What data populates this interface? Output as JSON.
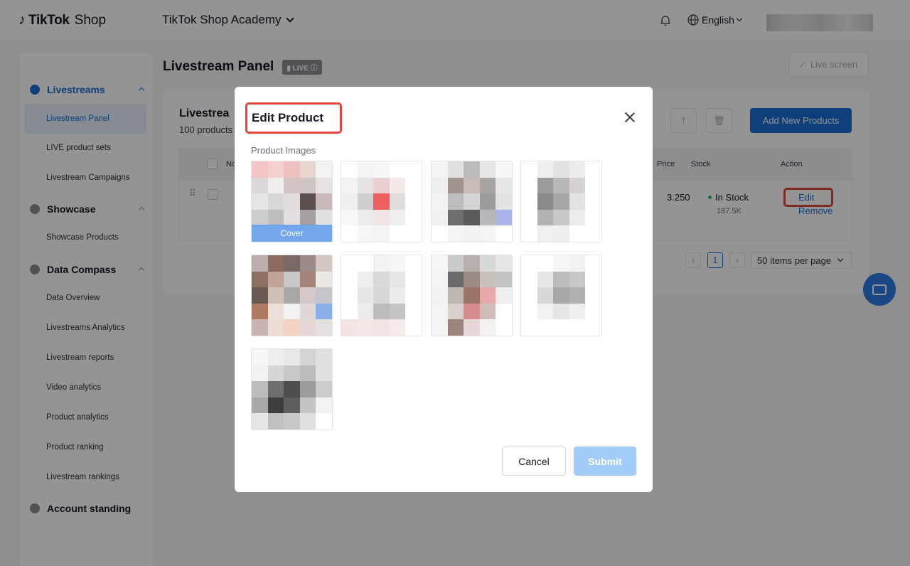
{
  "header": {
    "brand": "TikTok",
    "brand_suffix": "Shop",
    "academy": "TikTok Shop Academy",
    "language": "English"
  },
  "sidebar": {
    "sections": [
      {
        "label": "Livestreams",
        "items": [
          "Livestream Panel",
          "LIVE product sets",
          "Livestream Campaigns"
        ]
      },
      {
        "label": "Showcase",
        "items": [
          "Showcase Products"
        ]
      },
      {
        "label": "Data Compass",
        "items": [
          "Data Overview",
          "Livestreams Analytics",
          "Livestream reports",
          "Video analytics",
          "Product analytics",
          "Product ranking",
          "Livestream rankings"
        ]
      },
      {
        "label": "Account standing",
        "items": []
      }
    ]
  },
  "main": {
    "title": "Livestream Panel",
    "live_badge": "LIVE",
    "live_screen": "Live screen",
    "card_title": "Livestrea",
    "card_sub": "100 products",
    "add_button": "Add New Products",
    "columns": {
      "no": "No",
      "price": "Price",
      "stock": "Stock",
      "action": "Action"
    },
    "row": {
      "price": "3.250",
      "stock_status": "In Stock",
      "stock_qty": "187.5K",
      "edit": "Edit",
      "remove": "Remove"
    },
    "pagination": {
      "page": "1",
      "per_page": "50 items per page"
    }
  },
  "modal": {
    "title": "Edit Product",
    "images_label": "Product Images",
    "cover_label": "Cover",
    "cancel": "Cancel",
    "submit": "Submit",
    "images": [
      [
        "#f2c6c6",
        "#f4d0d0",
        "#efc0c0",
        "#ead6d0",
        "#f2f2f2",
        "#dcd8d8",
        "#eeeeee",
        "#d4c4c4",
        "#cfc5c5",
        "#e8e2e2",
        "#e6e6e6",
        "#d8d8d8",
        "#e2dcdc",
        "#5a5050",
        "#c8b8b8",
        "#cccccc",
        "#bdbdbd",
        "#e2dede",
        "#a8a0a0",
        "#e0e0e0",
        "#ffffff",
        "#ffffff",
        "#ffffff",
        "#ffffff",
        "#ffffff"
      ],
      [
        "#ffffff",
        "#f4f4f4",
        "#f6f6f6",
        "#ffffff",
        "#ffffff",
        "#f2f2f2",
        "#e6e2e2",
        "#ead0d0",
        "#f4e8e8",
        "#ffffff",
        "#efefef",
        "#cfcfcf",
        "#f06060",
        "#e0dcdc",
        "#ffffff",
        "#f8f8f8",
        "#ececec",
        "#f2e4e4",
        "#eeeeee",
        "#ffffff",
        "#ffffff",
        "#f6f6f6",
        "#f4f4f4",
        "#ffffff",
        "#ffffff"
      ],
      [
        "#f4f4f4",
        "#e0e0e0",
        "#bcbcbc",
        "#e6e6e6",
        "#f6f6f6",
        "#eeeeee",
        "#a0948e",
        "#c8bcb8",
        "#a8a4a4",
        "#e6e6e6",
        "#f2f2f2",
        "#bdbdbd",
        "#d4d4d4",
        "#9c9c9c",
        "#e2e2e2",
        "#f0f0f0",
        "#6e6e6e",
        "#5a5a5a",
        "#b8b8bc",
        "#aab4ea",
        "#ffffff",
        "#f4f4f4",
        "#f2f2f2",
        "#f4f4f4",
        "#ffffff"
      ],
      [
        "#ffffff",
        "#efefef",
        "#e2e2e2",
        "#ececec",
        "#ffffff",
        "#ffffff",
        "#9c9c9c",
        "#b8b8b8",
        "#d6d2d2",
        "#ffffff",
        "#ffffff",
        "#8a8a8a",
        "#a6a6a6",
        "#e2e2e2",
        "#ffffff",
        "#ffffff",
        "#b2b2b2",
        "#c8c8c8",
        "#ececec",
        "#ffffff",
        "#ffffff",
        "#f0f0f0",
        "#eeeeee",
        "#ffffff",
        "#ffffff"
      ],
      [
        "#bcaeac",
        "#8c6a60",
        "#7a6a66",
        "#9c8a86",
        "#d4c8c4",
        "#8c7060",
        "#c0a498",
        "#c8c8c8",
        "#a48478",
        "#ece8e6",
        "#6a5a56",
        "#d0c0b8",
        "#a8a8a8",
        "#d4c8c8",
        "#c8c4cc",
        "#b07a62",
        "#ece0da",
        "#f2f2f2",
        "#e0d8d8",
        "#8ab0e6",
        "#c8b4b0",
        "#ecdcd6",
        "#f4d2c4",
        "#e6d8d4",
        "#e4e0e0"
      ],
      [
        "#ffffff",
        "#ffffff",
        "#f2f2f2",
        "#f6f6f6",
        "#ffffff",
        "#ffffff",
        "#eeeeee",
        "#dadada",
        "#e6e6e6",
        "#ffffff",
        "#ffffff",
        "#e6e6e6",
        "#d8d8d8",
        "#ececec",
        "#ffffff",
        "#ffffff",
        "#ececec",
        "#bcbcbc",
        "#c4c4c4",
        "#ffffff",
        "#f4e4e4",
        "#f6e8e8",
        "#f2e4e4",
        "#f6eaea",
        "#ffffff"
      ],
      [
        "#f6f6f6",
        "#cacaca",
        "#b8b0ac",
        "#d8d8d8",
        "#e6e6e6",
        "#f4f4f4",
        "#6a6a6a",
        "#9c8a84",
        "#c8c0bc",
        "#c4c4c4",
        "#f2f2f2",
        "#c0b8b4",
        "#9c7466",
        "#e6a8a8",
        "#eeeeee",
        "#f4f4f4",
        "#d8d0cc",
        "#d48c8c",
        "#d0bcb8",
        "#ffffff",
        "#f4f4f4",
        "#9c847c",
        "#e6d8d6",
        "#f2f2f2",
        "#ffffff"
      ],
      [
        "#ffffff",
        "#ffffff",
        "#f6f6f6",
        "#f2f2f2",
        "#ffffff",
        "#ffffff",
        "#e6e6e6",
        "#bcbcbc",
        "#c8c8c8",
        "#ffffff",
        "#ffffff",
        "#d8d8d8",
        "#a8a8a8",
        "#b0b0b0",
        "#ffffff",
        "#ffffff",
        "#f2f2f2",
        "#e6e6e6",
        "#efefef",
        "#ffffff",
        "#ffffff",
        "#ffffff",
        "#ffffff",
        "#ffffff",
        "#ffffff"
      ],
      [
        "#f6f6f6",
        "#eeeeee",
        "#e8e8e8",
        "#d4d4d4",
        "#e0e0e0",
        "#f2f2f2",
        "#d6d6d6",
        "#c8c8c8",
        "#bcbcbc",
        "#e0e0e0",
        "#bcbcbc",
        "#6e6e6e",
        "#4e4e4e",
        "#9c9c9c",
        "#cccccc",
        "#a8a8a8",
        "#3e3e3e",
        "#5e5e5e",
        "#c4c4c4",
        "#f2f2f2",
        "#e6e6e6",
        "#c0c0c0",
        "#c8c8c8",
        "#e0e0e0",
        "#ffffff"
      ]
    ]
  },
  "colors": {
    "accent": "#1a6dd4",
    "highlight": "#e0473b",
    "submit_disabled": "#a3cdf8"
  }
}
